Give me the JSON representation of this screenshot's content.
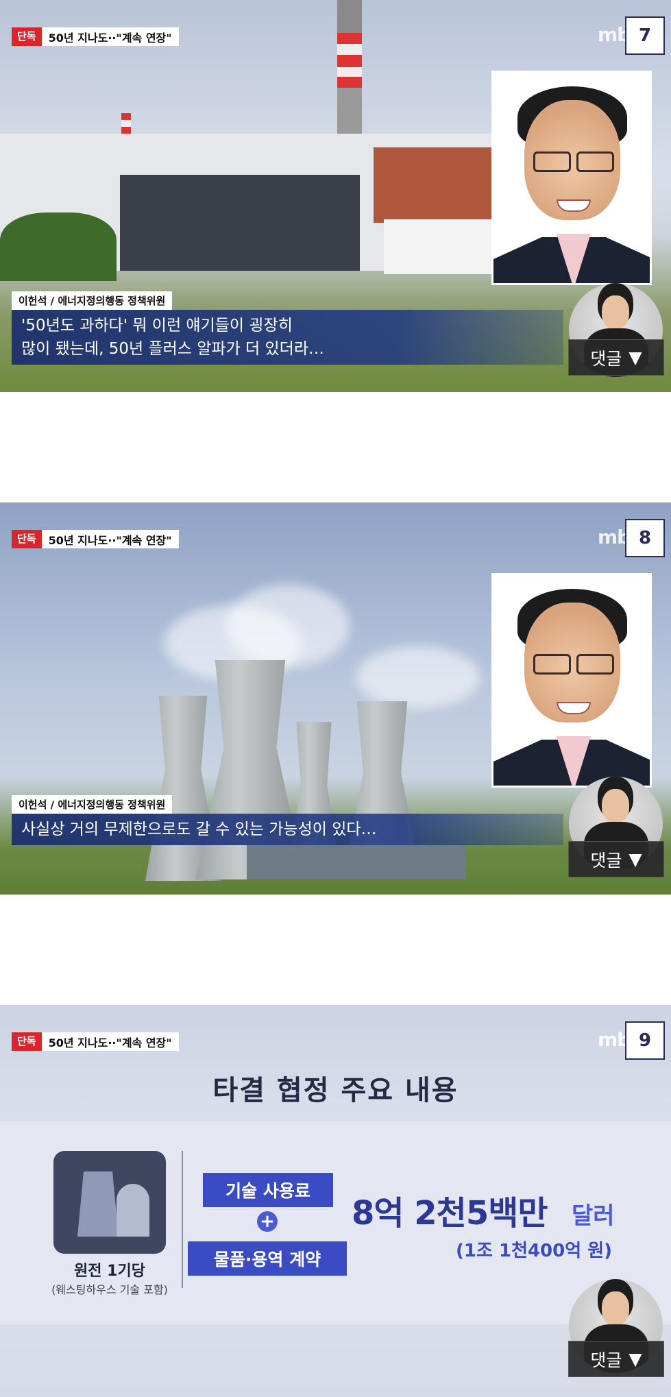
{
  "common": {
    "tag_red": "단독",
    "tag_text": "50년 지나도··\"계속 연장\"",
    "logo": "mb",
    "comment_label": "댓글",
    "comment_arrow": "▼"
  },
  "panels": [
    {
      "number": "7",
      "speaker": "이헌석 / 에너지정의행동 정책위원",
      "subtitle_lines": [
        "'50년도 과하다' 뭐 이런 얘기들이 굉장히",
        "많이 됐는데, 50년 플러스 알파가 더 있더라…"
      ]
    },
    {
      "number": "8",
      "speaker": "이헌석 / 에너지정의행동 정책위원",
      "subtitle_lines": [
        "사실상 거의 무제한으로도 갈 수 있는 가능성이 있다…"
      ]
    },
    {
      "number": "9",
      "title": "타결 협정 주요 내용",
      "icon_label": "원전 1기당",
      "icon_sub": "(웨스팅하우스 기술 포함)",
      "chip_1": "기술 사용료",
      "plus": "+",
      "chip_2": "물품·용역 계약",
      "amount": "8억 2천5백만",
      "amount_unit": "달러",
      "amount_sub": "(1조 1천400억 원)"
    }
  ]
}
